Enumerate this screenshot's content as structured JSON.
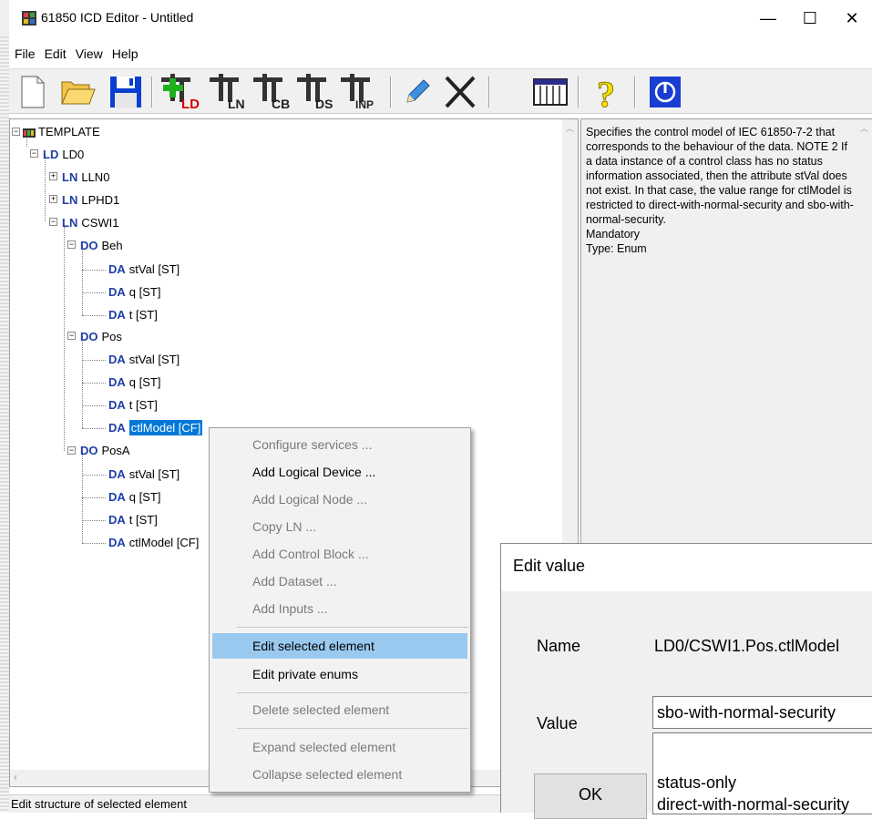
{
  "window": {
    "title": "61850 ICD Editor - Untitled",
    "minimize": "—",
    "maximize": "☐",
    "close": "✕"
  },
  "menu": [
    "File",
    "Edit",
    "View",
    "Help"
  ],
  "toolbar": {
    "new_icon": "new-file-icon",
    "open_icon": "open-folder-icon",
    "save_icon": "save-icon",
    "add_ld": "LD",
    "add_ln": "LN",
    "add_cb": "CB",
    "add_ds": "DS",
    "add_inp": "INP",
    "edit_icon": "pencil-icon",
    "delete_icon": "cross-icon",
    "table_icon": "table-icon",
    "help_icon": "question-icon",
    "exit_icon": "power-icon"
  },
  "tree": {
    "root": {
      "tag": "",
      "label": "TEMPLATE"
    },
    "nodes": [
      {
        "tag": "LD",
        "label": "LD0"
      },
      {
        "tag": "LN",
        "label": "LLN0"
      },
      {
        "tag": "LN",
        "label": "LPHD1"
      },
      {
        "tag": "LN",
        "label": "CSWI1"
      },
      {
        "tag": "DO",
        "label": "Beh"
      },
      {
        "tag": "DA",
        "label": "stVal [ST]"
      },
      {
        "tag": "DA",
        "label": "q [ST]"
      },
      {
        "tag": "DA",
        "label": "t [ST]"
      },
      {
        "tag": "DO",
        "label": "Pos"
      },
      {
        "tag": "DA",
        "label": "stVal [ST]"
      },
      {
        "tag": "DA",
        "label": "q [ST]"
      },
      {
        "tag": "DA",
        "label": "t [ST]"
      },
      {
        "tag": "DA",
        "label": "ctlModel [CF]"
      },
      {
        "tag": "DO",
        "label": "PosA"
      },
      {
        "tag": "DA",
        "label": "stVal [ST]"
      },
      {
        "tag": "DA",
        "label": "q [ST]"
      },
      {
        "tag": "DA",
        "label": "t [ST]"
      },
      {
        "tag": "DA",
        "label": "ctlModel [CF]"
      }
    ]
  },
  "description": {
    "text": "Specifies the control model of IEC 61850-7-2 that corresponds to the behaviour of the data.  NOTE 2 If a data instance of a control class has no status information associated, then the attribute stVal does not exist. In that case, the value range for ctlModel is restricted to direct-with-normal-security and sbo-with-normal-security.",
    "mandatory": "Mandatory",
    "type": "Type: Enum"
  },
  "context_menu": {
    "items": [
      {
        "label": "Configure services ...",
        "disabled": true
      },
      {
        "label": "Add Logical Device ...",
        "disabled": false
      },
      {
        "label": "Add Logical Node ...",
        "disabled": true
      },
      {
        "label": "Copy LN ...",
        "disabled": true
      },
      {
        "label": "Add Control Block ...",
        "disabled": true
      },
      {
        "label": "Add Dataset ...",
        "disabled": true
      },
      {
        "label": "Add Inputs ...",
        "disabled": true
      },
      {
        "label": "Edit selected element",
        "disabled": false
      },
      {
        "label": "Edit private enums",
        "disabled": false
      },
      {
        "label": "Delete selected element",
        "disabled": true
      },
      {
        "label": "Expand selected element",
        "disabled": true
      },
      {
        "label": "Collapse selected element",
        "disabled": true
      }
    ]
  },
  "dialog": {
    "title": "Edit value",
    "name_label": "Name",
    "name_value": "LD0/CSWI1.Pos.ctlModel",
    "value_label": "Value",
    "value_current": "sbo-with-normal-security",
    "options": [
      "status-only",
      "direct-with-normal-security"
    ],
    "ok_label": "OK"
  },
  "status": "Edit structure of selected element"
}
